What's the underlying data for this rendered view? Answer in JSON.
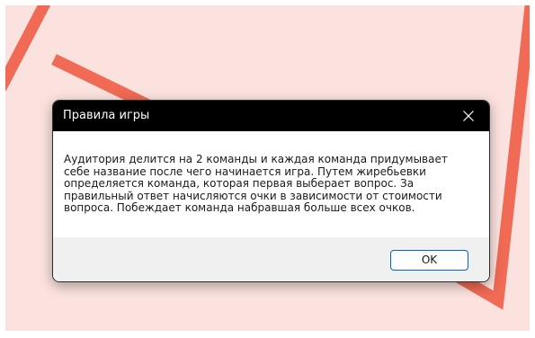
{
  "dialog": {
    "title": "Правила игры",
    "message": "Аудитория делится на 2 команды и каждая команда придумывает себе название после чего начинается игра. Путем жиребьевки определяется команда, которая первая выберает вопрос. За правильный ответ начисляются очки в зависимости от стоимости вопроса. Побеждает команда набравшая больше всех очков.",
    "ok_label": "OK",
    "close_icon": "close-icon"
  },
  "theme": {
    "backdrop_color": "#fce2df",
    "stripe_color": "#f06a55",
    "titlebar_color": "#000000",
    "accent_color": "#0067c0",
    "footer_color": "#f0f0f0"
  }
}
